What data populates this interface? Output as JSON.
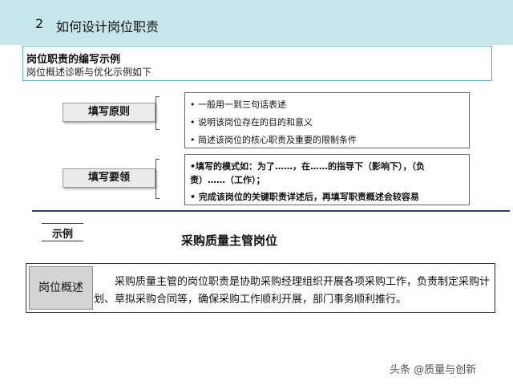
{
  "header": {
    "number": "2",
    "title": "如何设计岗位职责"
  },
  "intro": {
    "heading": "岗位职责的编写示例",
    "subheading": "岗位概述诊断与优化示例如下"
  },
  "principles": {
    "label": "填写原则",
    "items": [
      "• 一般用一到三句话表述",
      "• 说明该岗位存在的目的和意义",
      "• 简述该岗位的核心职责及重要的限制条件"
    ]
  },
  "essentials": {
    "label": "填写要领",
    "items": [
      "•填写的模式如：为了……，在……的指导下（影响下），（负",
      "责）……（工作）；",
      "• 完成该岗位的关键职责详述后，再填写职责概述会较容易"
    ]
  },
  "example": {
    "tab_label": "示例",
    "title": "采购质量主管岗位",
    "overview_label": "岗位概述",
    "overview_text": "采购质量主管的岗位职责是协助采购经理组织开展各项采购工作，负责制定采购计划、草拟采购合同等，确保采购工作顺利开展，部门事务顺利推行。"
  },
  "watermark": "头条 @质量与创新"
}
